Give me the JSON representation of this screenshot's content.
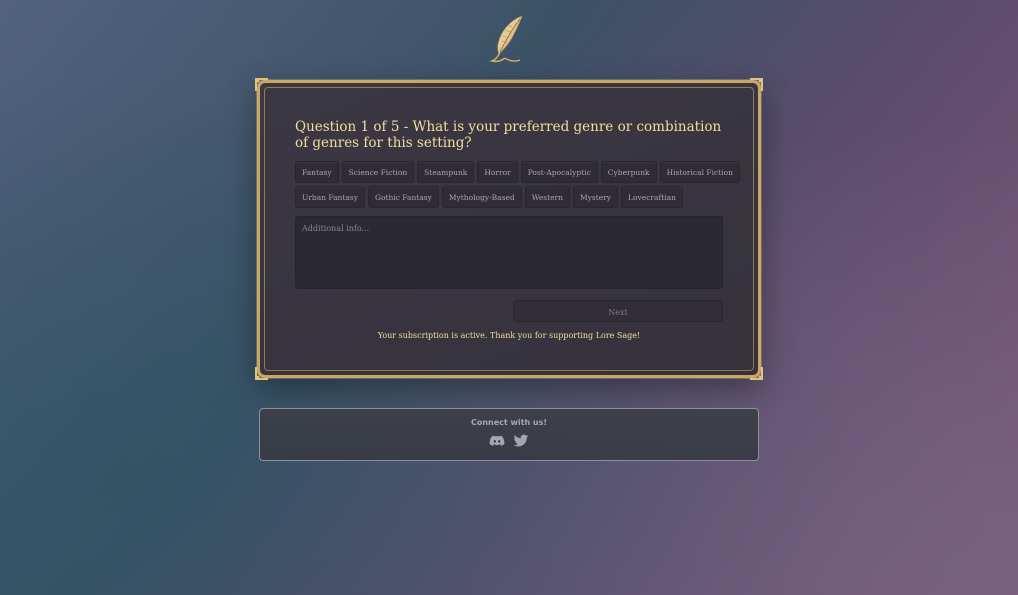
{
  "question": {
    "text": "Question 1 of 5 - What is your preferred genre or combination of genres for this setting?"
  },
  "genres": {
    "row1": [
      {
        "label": "Fantasy"
      },
      {
        "label": "Science Fiction"
      },
      {
        "label": "Steampunk"
      },
      {
        "label": "Horror"
      },
      {
        "label": "Post-Apocalyptic"
      },
      {
        "label": "Cyberpunk"
      },
      {
        "label": "Historical Fiction"
      }
    ],
    "row2": [
      {
        "label": "Urban Fantasy"
      },
      {
        "label": "Gothic Fantasy"
      },
      {
        "label": "Mythology-Based"
      },
      {
        "label": "Western"
      },
      {
        "label": "Mystery"
      },
      {
        "label": "Lovecraftian"
      }
    ]
  },
  "additional_info": {
    "placeholder": "Additional info...",
    "value": ""
  },
  "next_button": {
    "label": "Next"
  },
  "subscription": {
    "message": "Your subscription is active. Thank you for supporting Lore Sage!"
  },
  "connect": {
    "title": "Connect with us!",
    "icons": [
      "discord-icon",
      "twitter-icon"
    ]
  },
  "colors": {
    "accent_gold": "#c9a866",
    "question_text": "#f1dea0",
    "card_bg": "#38353f",
    "chip_bg": "#2f2c35"
  }
}
